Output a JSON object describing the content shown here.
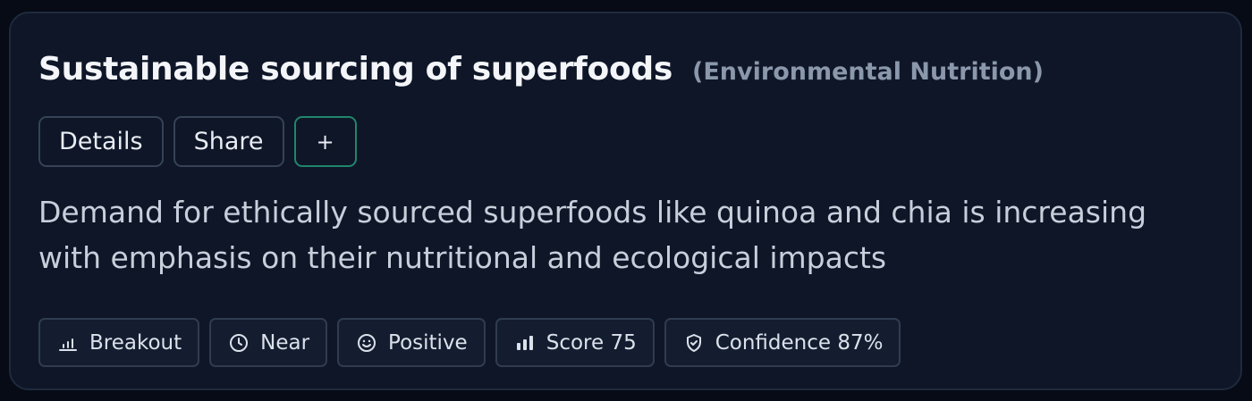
{
  "card": {
    "title": "Sustainable sourcing of superfoods",
    "category": "(Environmental Nutrition)",
    "actions": {
      "details_label": "Details",
      "share_label": "Share",
      "add_label": "+"
    },
    "description": "Demand for ethically sourced superfoods like quinoa and chia is increasing with emphasis on their nutritional and ecological impacts",
    "chips": [
      {
        "icon": "bar-chart-icon",
        "label": "Breakout"
      },
      {
        "icon": "clock-icon",
        "label": "Near"
      },
      {
        "icon": "smiley-icon",
        "label": "Positive"
      },
      {
        "icon": "signal-bars-icon",
        "label": "Score 75"
      },
      {
        "icon": "shield-check-icon",
        "label": "Confidence 87%"
      }
    ]
  },
  "colors": {
    "background": "#060b16",
    "card": "#0e1628",
    "accent_green": "#21856b",
    "category_text": "#8b97ab"
  }
}
